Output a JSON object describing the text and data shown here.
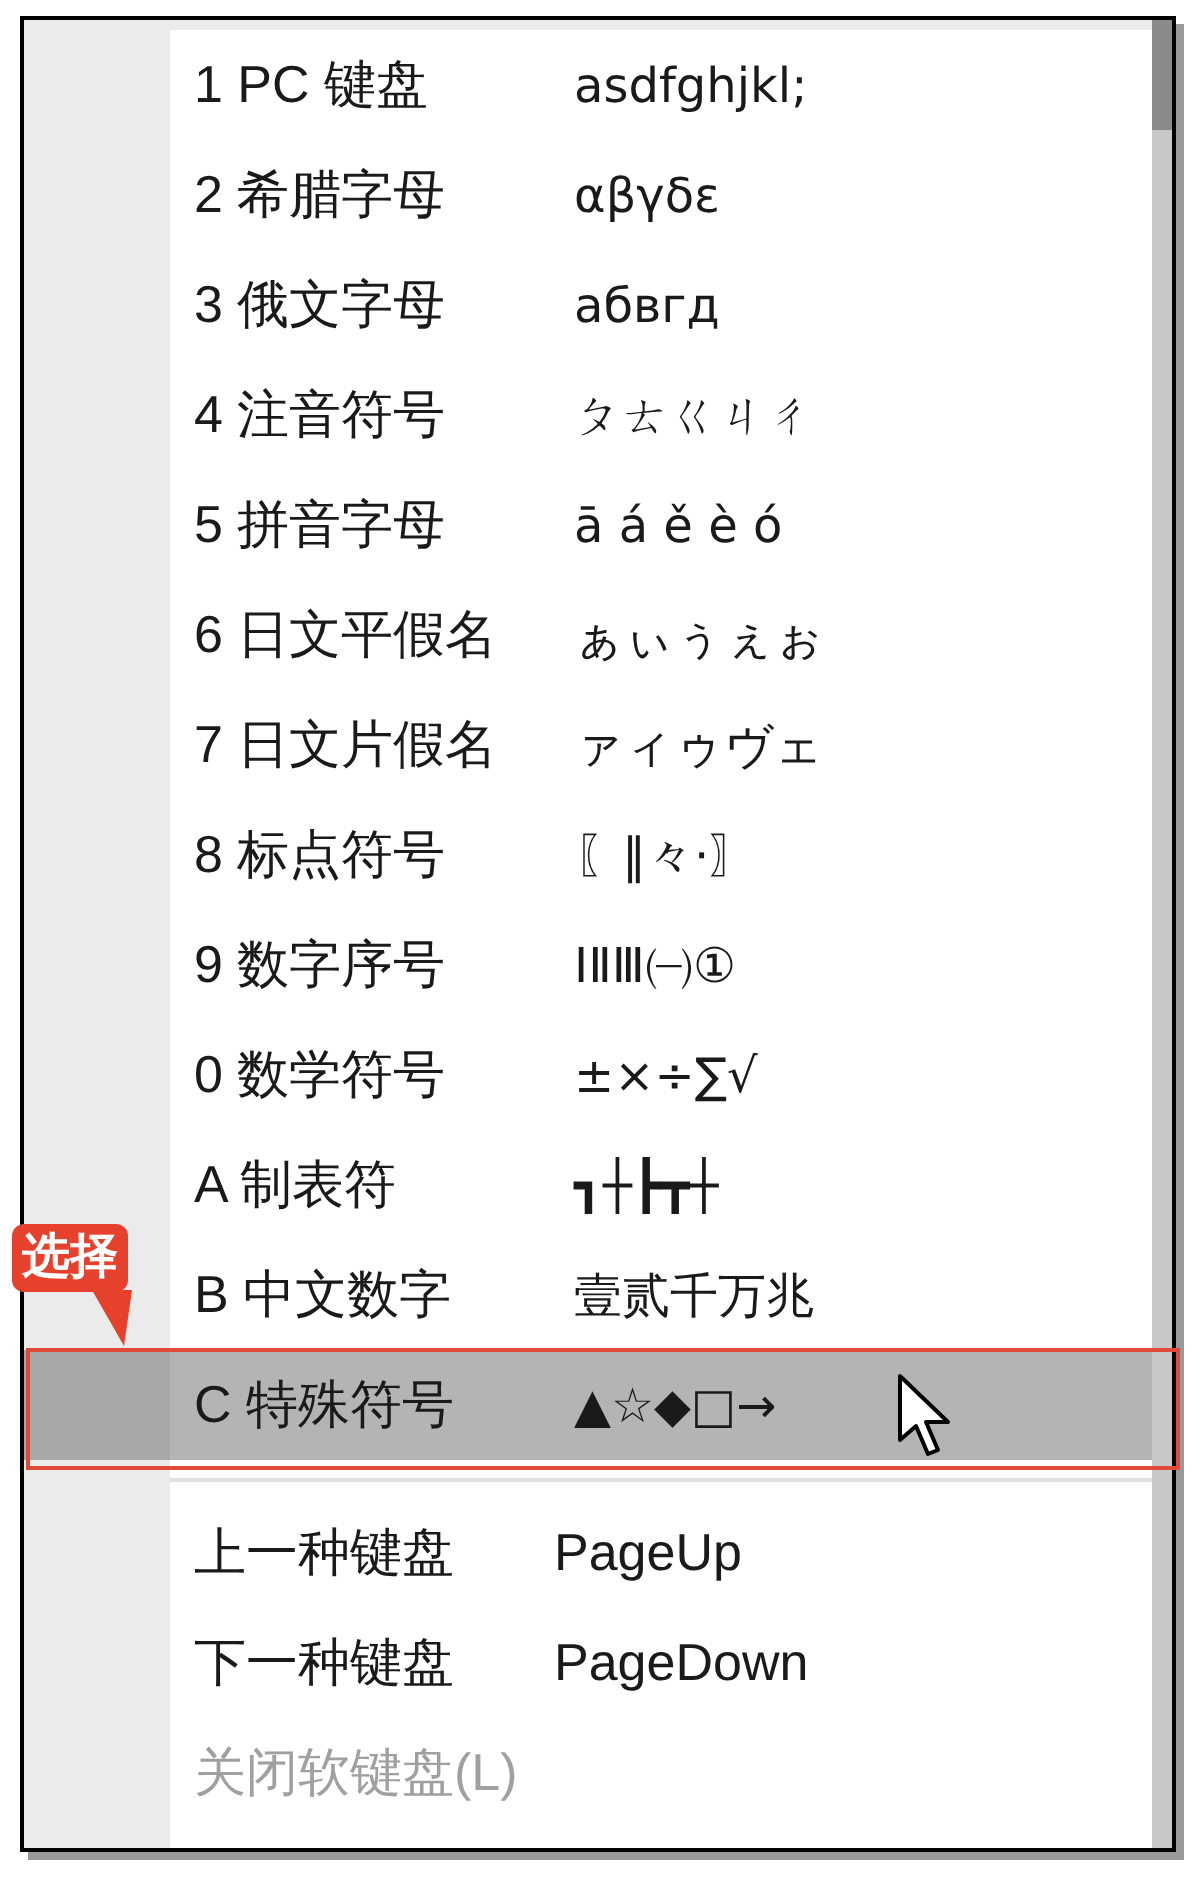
{
  "menu": {
    "items": [
      {
        "label": "1 PC 键盘",
        "sample": "asdfghjkl;",
        "selected": false
      },
      {
        "label": "2 希腊字母",
        "sample": "αβγδε",
        "selected": false
      },
      {
        "label": "3 俄文字母",
        "sample": "абвгд",
        "selected": false
      },
      {
        "label": "4 注音符号",
        "sample": "ㄆㄊㄍㄐㄔ",
        "selected": false
      },
      {
        "label": "5 拼音字母",
        "sample": "ā á ě è ó",
        "selected": false
      },
      {
        "label": "6 日文平假名",
        "sample": "ぁぃぅぇぉ",
        "selected": false
      },
      {
        "label": "7 日文片假名",
        "sample": "ァィゥヴェ",
        "selected": false
      },
      {
        "label": "8 标点符号",
        "sample": "〖‖々·〗",
        "selected": false
      },
      {
        "label": "9 数字序号",
        "sample": "ⅠⅡⅢ㈠①",
        "selected": false
      },
      {
        "label": "0 数学符号",
        "sample": "±×÷∑√",
        "selected": false
      },
      {
        "label": "A 制表符",
        "sample": "┓┼┣┳┼",
        "selected": false
      },
      {
        "label": "B 中文数字",
        "sample": "壹贰千万兆",
        "selected": false
      },
      {
        "label": "C 特殊符号",
        "sample": "▲☆◆□→",
        "selected": true
      }
    ],
    "footer_items": [
      {
        "label": "上一种键盘",
        "shortcut": "PageUp",
        "disabled": false
      },
      {
        "label": "下一种键盘",
        "shortcut": "PageDown",
        "disabled": false
      },
      {
        "label": "关闭软键盘(L)",
        "disabled": true
      }
    ]
  },
  "annotation": {
    "label": "选择"
  }
}
